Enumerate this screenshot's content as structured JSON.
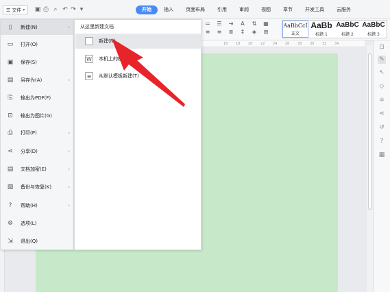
{
  "toolbar": {
    "file_label": "文件",
    "quick_access": [
      "save-icon",
      "print-icon",
      "print-preview-icon",
      "undo-icon",
      "redo-icon",
      "more-icon"
    ]
  },
  "tabs": [
    {
      "label": "开始",
      "active": true
    },
    {
      "label": "插入"
    },
    {
      "label": "页面布局"
    },
    {
      "label": "引用"
    },
    {
      "label": "审阅"
    },
    {
      "label": "视图"
    },
    {
      "label": "章节"
    },
    {
      "label": "开发工具"
    },
    {
      "label": "云服务"
    }
  ],
  "ribbon": {
    "styles": [
      {
        "sample": "AaBbCcI",
        "name": "正文"
      },
      {
        "sample": "AaBb",
        "name": "标题 1"
      },
      {
        "sample": "AaBbC",
        "name": "标题 2"
      },
      {
        "sample": "AaBbC",
        "name": "标题 3"
      }
    ]
  },
  "ruler": {
    "marks": [
      "16",
      "18",
      "20",
      "22",
      "24",
      "26",
      "28",
      "30",
      "32",
      "34"
    ]
  },
  "file_menu": {
    "items": [
      {
        "label": "新建(N)",
        "icon": "new-doc-icon",
        "submenu": true,
        "active": true
      },
      {
        "label": "打开(O)",
        "icon": "folder-icon"
      },
      {
        "label": "保存(S)",
        "icon": "save-icon"
      },
      {
        "label": "另存为(A)",
        "icon": "save-as-icon",
        "submenu": true
      },
      {
        "label": "输出为PDF(F)",
        "icon": "pdf-icon"
      },
      {
        "label": "输出为图片(G)",
        "icon": "image-export-icon"
      },
      {
        "label": "打印(P)",
        "icon": "print-icon",
        "submenu": true
      },
      {
        "label": "分享(D)",
        "icon": "share-icon",
        "submenu": true
      },
      {
        "label": "文档加密(E)",
        "icon": "encrypt-icon",
        "submenu": true
      },
      {
        "label": "备份与恢复(K)",
        "icon": "backup-icon",
        "submenu": true
      },
      {
        "label": "帮助(H)",
        "icon": "help-icon",
        "submenu": true
      },
      {
        "label": "选项(L)",
        "icon": "settings-icon"
      },
      {
        "label": "退出(Q)",
        "icon": "exit-icon"
      }
    ]
  },
  "new_submenu": {
    "title": "从这里新建文档",
    "items": [
      {
        "label": "新建(N)",
        "highlighted": true
      },
      {
        "label": "本机上的模板(M)..."
      },
      {
        "label": "从默认模板新建(T)"
      }
    ]
  },
  "annotation": {
    "color": "#e8242b"
  }
}
